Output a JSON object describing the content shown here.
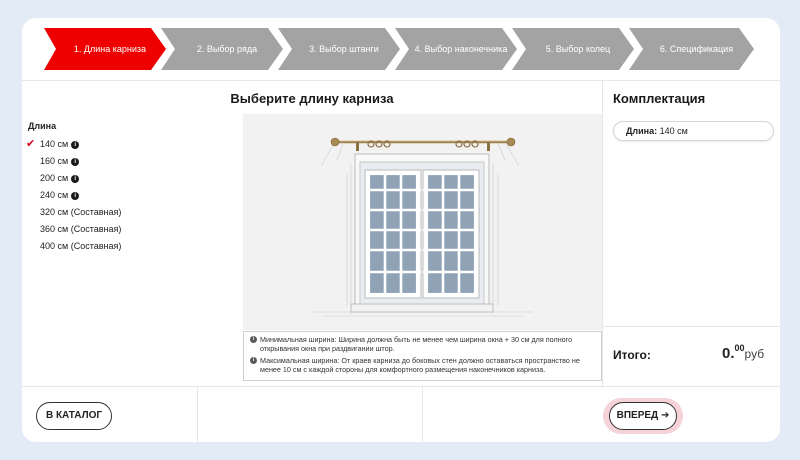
{
  "stepper": {
    "steps": [
      {
        "label": "1. Длина карниза",
        "active": true
      },
      {
        "label": "2. Выбор ряда",
        "active": false
      },
      {
        "label": "3. Выбор штанги",
        "active": false
      },
      {
        "label": "4. Выбор наконечника",
        "active": false
      },
      {
        "label": "5. Выбор колец",
        "active": false
      },
      {
        "label": "6. Спецификация",
        "active": false
      }
    ],
    "active_color": "#ee0000",
    "inactive_color": "#a3a3a3"
  },
  "main": {
    "title": "Выберите длину карниза",
    "length_label": "Длина",
    "options": [
      {
        "label": "140 см",
        "selected": true,
        "info": true
      },
      {
        "label": "160 см",
        "selected": false,
        "info": true
      },
      {
        "label": "200 см",
        "selected": false,
        "info": true
      },
      {
        "label": "240 см",
        "selected": false,
        "info": true
      },
      {
        "label": "320 см (Составная)",
        "selected": false,
        "info": false
      },
      {
        "label": "360 см (Составная)",
        "selected": false,
        "info": false
      },
      {
        "label": "400 см (Составная)",
        "selected": false,
        "info": false
      }
    ],
    "notes": [
      "Минимальная ширина: Ширина должна быть не менее чем ширина окна + 30 см для полного открывания окна при раздвигании штор.",
      "Максимальная ширина: От краев карниза до боковых стен должно оставаться пространство не менее 10 см с каждой стороны для комфортного размещения наконечников карниза."
    ]
  },
  "sidebar": {
    "title": "Комплектация",
    "summary_label": "Длина:",
    "summary_value": "140 см",
    "total_label": "Итого:",
    "total_int": "0.",
    "total_frac": "00",
    "total_currency": "руб"
  },
  "footer": {
    "catalog_label": "В КАТАЛОГ",
    "next_label": "ВПЕРЕД",
    "next_arrow": "➔"
  },
  "icons": {
    "check": "✔",
    "info": "i"
  }
}
